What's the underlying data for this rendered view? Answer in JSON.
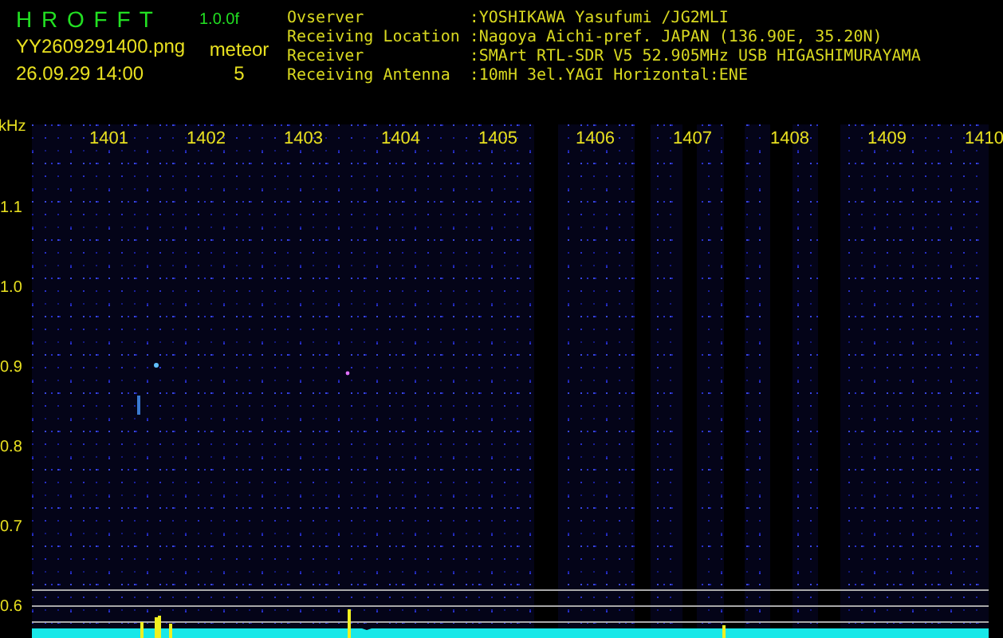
{
  "app": {
    "name": "H R O F F T",
    "version": "1.0.0f"
  },
  "file": {
    "name": "YY2609291400.png",
    "datetime": "26.09.29 14:00"
  },
  "meteor": {
    "label": "meteor",
    "count": "5"
  },
  "station": [
    {
      "label": "Ovserver",
      "value": ":YOSHIKAWA Yasufumi /JG2MLI"
    },
    {
      "label": "Receiving Location",
      "value": ":Nagoya Aichi-pref. JAPAN (136.90E, 35.20N)"
    },
    {
      "label": "Receiver",
      "value": ":SMArt RTL-SDR V5 52.905MHz USB HIGASHIMURAYAMA"
    },
    {
      "label": "Receiving Antenna",
      "value": ":10mH 3el.YAGI Horizontal:ENE"
    }
  ],
  "plot": {
    "unit": "kHz",
    "y_labels": [
      "1.1",
      "1.0",
      "0.9",
      "0.8",
      "0.7",
      "0.6"
    ],
    "time_labels": [
      "1401",
      "1402",
      "1403",
      "1404",
      "1405",
      "1406",
      "1407",
      "1408",
      "1409",
      "1410"
    ]
  }
}
